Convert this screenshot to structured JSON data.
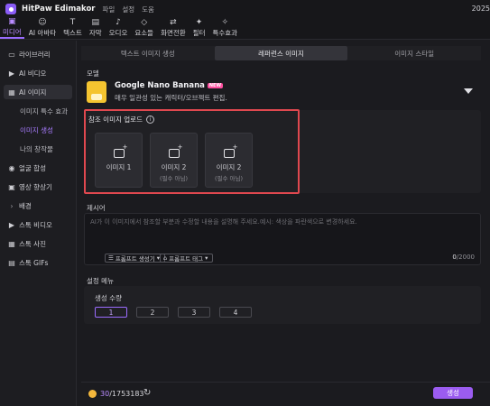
{
  "titlebar": {
    "app_title": "HitPaw Edimakor",
    "menus": [
      "파일",
      "설정",
      "도움"
    ],
    "year": "2025"
  },
  "toolbar": {
    "tools": [
      {
        "label": "미디어",
        "icon": "media-icon"
      },
      {
        "label": "AI 아바타",
        "icon": "ai-avatar-icon"
      },
      {
        "label": "텍스트",
        "icon": "text-icon"
      },
      {
        "label": "자막",
        "icon": "subtitle-icon"
      },
      {
        "label": "오디오",
        "icon": "audio-icon"
      },
      {
        "label": "요소들",
        "icon": "elements-icon"
      },
      {
        "label": "화면전환",
        "icon": "transition-icon"
      },
      {
        "label": "필터",
        "icon": "filter-icon"
      },
      {
        "label": "특수효과",
        "icon": "effects-icon"
      }
    ],
    "active_index": 0
  },
  "sidebar": {
    "library": "라이브러리",
    "ai_video": "AI 비디오",
    "ai_image": "AI 이미지",
    "sub_effects": "이미지 특수 효과",
    "sub_generate": "이미지 생성",
    "sub_my_works": "나의 창작물",
    "face_swap": "얼굴 합성",
    "enhance": "영상 향상기",
    "background": "배경",
    "stock_video": "스톡 비디오",
    "stock_photo": "스톡 사진",
    "stock_gif": "스톡 GIFs"
  },
  "tabs": [
    "텍스트 이미지 생성",
    "레퍼런스 이미지",
    "이미지 스타일"
  ],
  "model": {
    "section_label": "모델",
    "name": "Google Nano Banana",
    "badge": "NEW",
    "description": "매우 일관성 있는 캐릭터/오브젝트 편집."
  },
  "upload": {
    "title": "참조 이미지 업로드",
    "info": "i",
    "slots": [
      {
        "label": "이미지 1",
        "sub": ""
      },
      {
        "label": "이미지 2",
        "sub": "(필수 아님)"
      },
      {
        "label": "이미지 2",
        "sub": "(필수 아님)"
      }
    ]
  },
  "prompt": {
    "section_label": "제시어",
    "placeholder": "AI가 이 이미지에서 참조할 부분과 수정할 내용을 설명해 주세요.예시: 색상을 파란색으로 변경하세요.",
    "generator_btn": "프롬프트 생성기",
    "tag_btn": "프롬프트 태그",
    "count_current": "0",
    "count_max": "/2000"
  },
  "settings": {
    "section_label": "설정 메뉴",
    "count_title": "생성 수량",
    "counts": [
      "1",
      "2",
      "3",
      "4"
    ],
    "selected": "1"
  },
  "footer": {
    "credits_current": "30",
    "credits_total": "/1753183",
    "generate_label": "생성"
  },
  "colors": {
    "accent": "#9b5cf0",
    "highlight": "#e0484f",
    "coin": "#f3b73c"
  }
}
